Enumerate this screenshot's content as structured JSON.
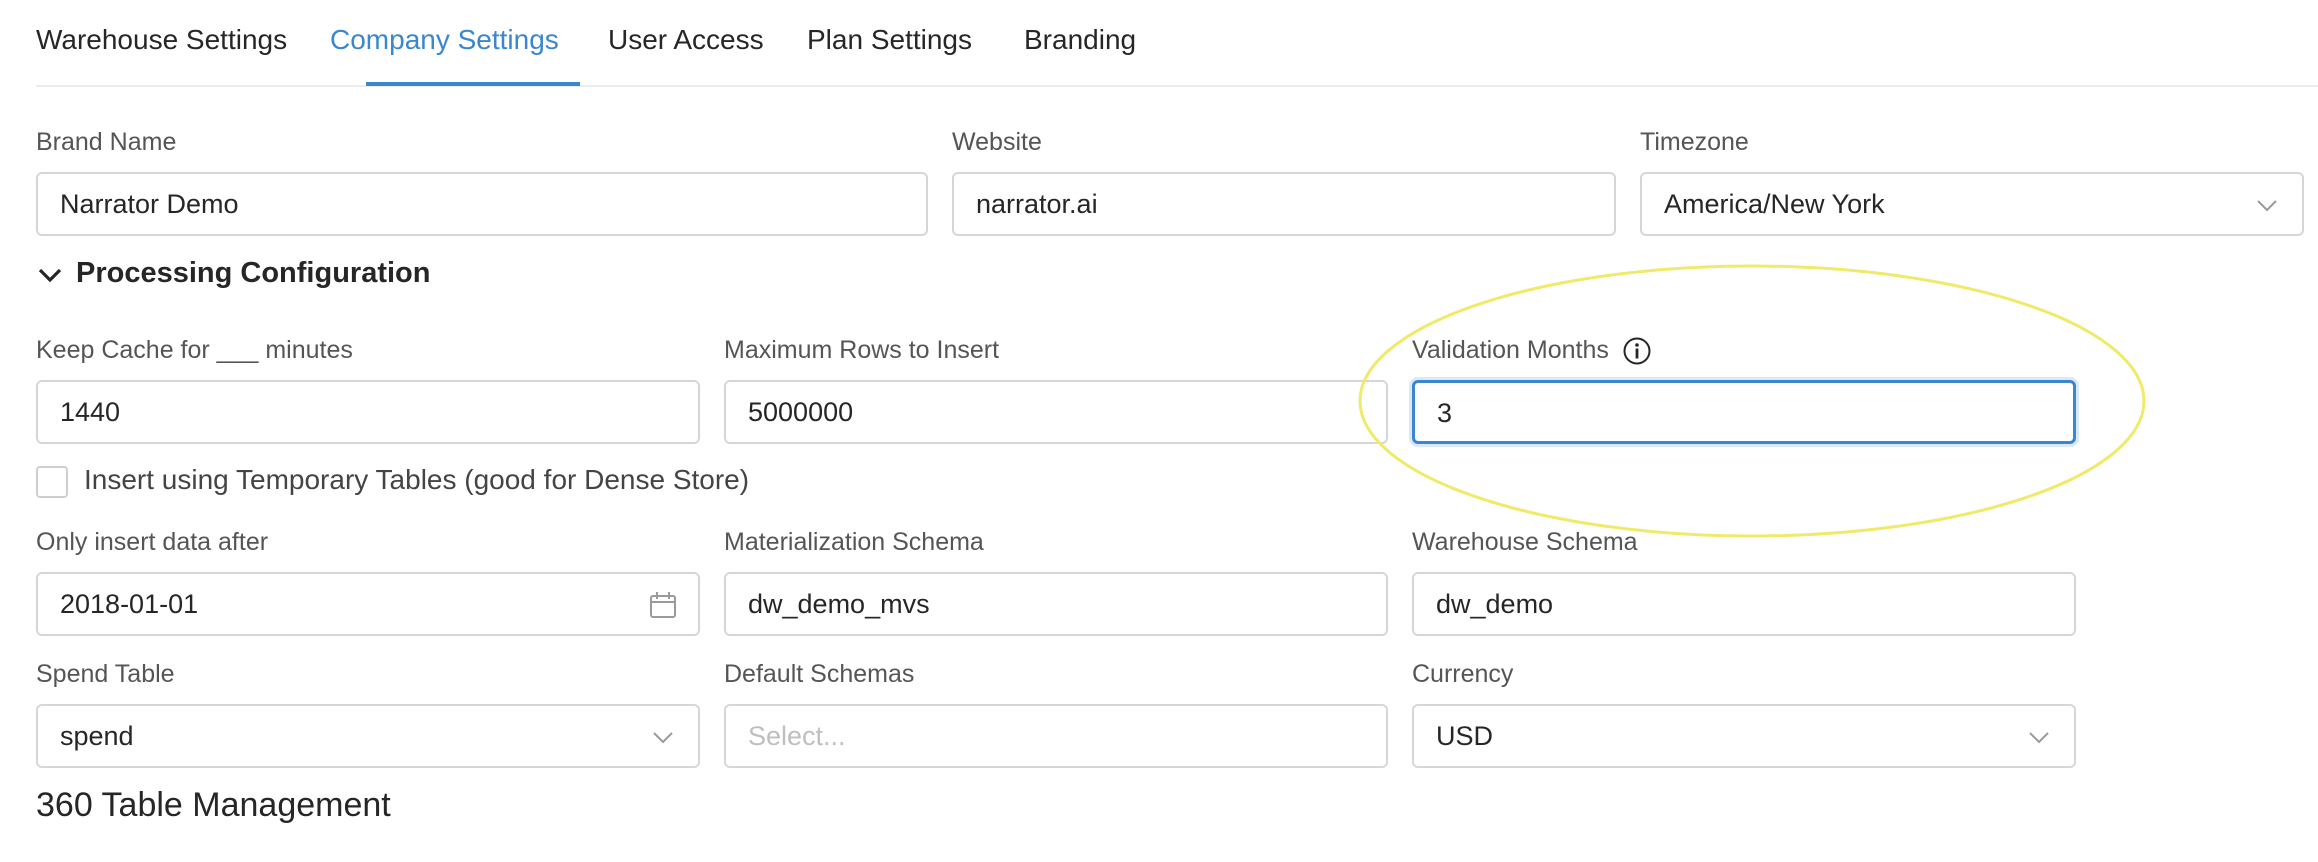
{
  "tabs": [
    {
      "label": "Warehouse Settings",
      "active": false
    },
    {
      "label": "Company Settings",
      "active": true
    },
    {
      "label": "User Access",
      "active": false
    },
    {
      "label": "Plan Settings",
      "active": false
    },
    {
      "label": "Branding",
      "active": false
    }
  ],
  "company": {
    "brand_name": {
      "label": "Brand Name",
      "value": "Narrator Demo"
    },
    "website": {
      "label": "Website",
      "value": "narrator.ai"
    },
    "timezone": {
      "label": "Timezone",
      "value": "America/New York",
      "icon": "chevron-down-icon"
    }
  },
  "processing": {
    "title": "Processing Configuration",
    "expanded": true,
    "keep_cache": {
      "label": "Keep Cache for ___ minutes",
      "value": "1440"
    },
    "max_rows": {
      "label": "Maximum Rows to Insert",
      "value": "5000000"
    },
    "validation_months": {
      "label": "Validation Months",
      "value": "3",
      "icon": "info-icon",
      "focused": true
    },
    "temp_tables": {
      "label": "Insert using Temporary Tables (good for Dense Store)",
      "checked": false
    },
    "insert_after": {
      "label": "Only insert data after",
      "value": "2018-01-01",
      "icon": "calendar-icon"
    },
    "materialization_schema": {
      "label": "Materialization Schema",
      "value": "dw_demo_mvs"
    },
    "warehouse_schema": {
      "label": "Warehouse Schema",
      "value": "dw_demo"
    },
    "spend_table": {
      "label": "Spend Table",
      "value": "spend",
      "icon": "chevron-down-icon"
    },
    "default_schemas": {
      "label": "Default Schemas",
      "placeholder": "Select..."
    },
    "currency": {
      "label": "Currency",
      "value": "USD",
      "icon": "chevron-down-icon"
    }
  },
  "table_management": {
    "title": "360 Table Management"
  },
  "colors": {
    "accent": "#3a87cd",
    "annotation": "#f0ea6a",
    "border": "#d6d6d6"
  }
}
